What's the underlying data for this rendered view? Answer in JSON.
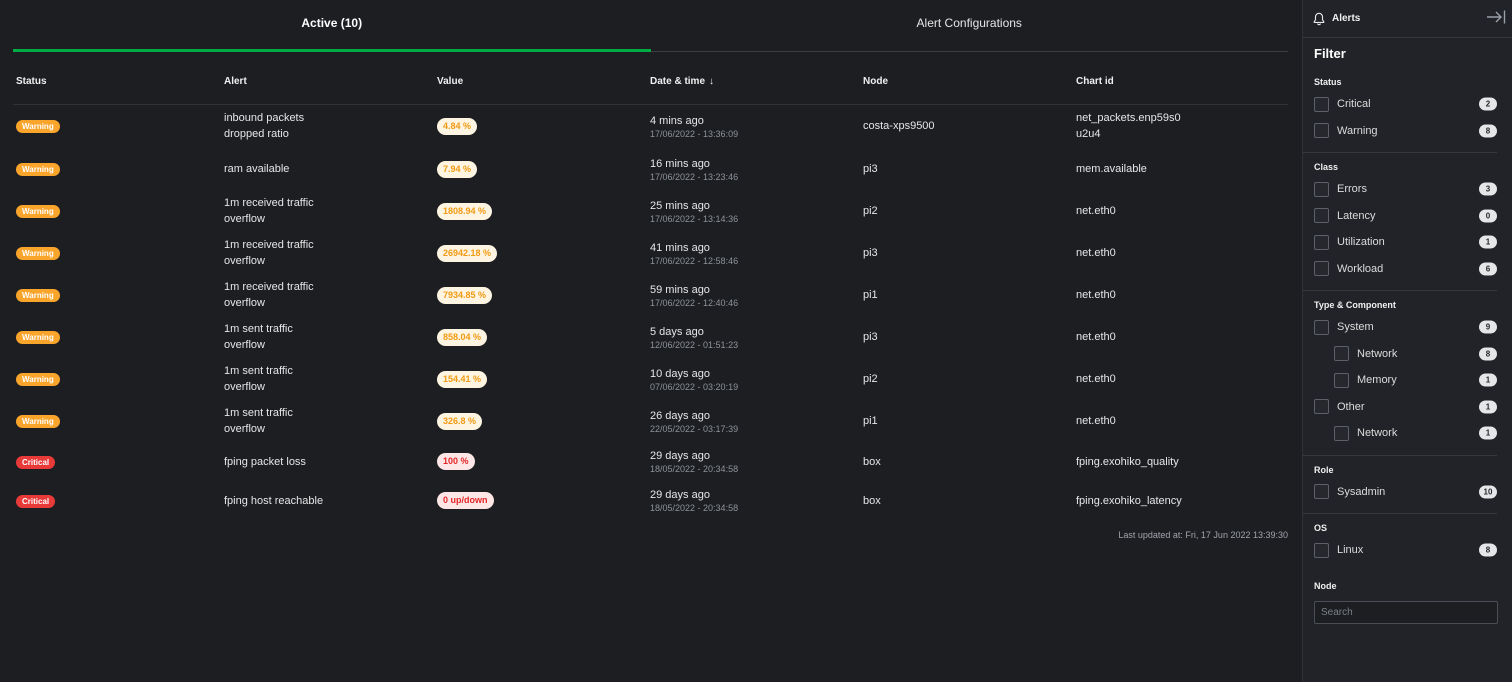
{
  "tabs": [
    {
      "label": "Active (10)",
      "active": true
    },
    {
      "label": "Alert Configurations",
      "active": false
    }
  ],
  "table": {
    "columns": [
      "Status",
      "Alert",
      "Value",
      "Date & time",
      "Node",
      "Chart id"
    ],
    "sorted_column": "Date & time",
    "rows": [
      {
        "status": "Warning",
        "alert_l1": "inbound packets",
        "alert_l2": "dropped ratio",
        "value": "4.84 %",
        "ago": "4 mins ago",
        "datetime": "17/06/2022 - 13:36:09",
        "node": "costa-xps9500",
        "chart_l1": "net_packets.enp59s0",
        "chart_l2": "u2u4"
      },
      {
        "status": "Warning",
        "alert_l1": "ram available",
        "alert_l2": "",
        "value": "7.94 %",
        "ago": "16 mins ago",
        "datetime": "17/06/2022 - 13:23:46",
        "node": "pi3",
        "chart_l1": "mem.available",
        "chart_l2": ""
      },
      {
        "status": "Warning",
        "alert_l1": "1m received traffic",
        "alert_l2": "overflow",
        "value": "1808.94 %",
        "ago": "25 mins ago",
        "datetime": "17/06/2022 - 13:14:36",
        "node": "pi2",
        "chart_l1": "net.eth0",
        "chart_l2": ""
      },
      {
        "status": "Warning",
        "alert_l1": "1m received traffic",
        "alert_l2": "overflow",
        "value": "26942.18 %",
        "ago": "41 mins ago",
        "datetime": "17/06/2022 - 12:58:46",
        "node": "pi3",
        "chart_l1": "net.eth0",
        "chart_l2": ""
      },
      {
        "status": "Warning",
        "alert_l1": "1m received traffic",
        "alert_l2": "overflow",
        "value": "7934.85 %",
        "ago": "59 mins ago",
        "datetime": "17/06/2022 - 12:40:46",
        "node": "pi1",
        "chart_l1": "net.eth0",
        "chart_l2": ""
      },
      {
        "status": "Warning",
        "alert_l1": "1m sent traffic",
        "alert_l2": "overflow",
        "value": "858.04 %",
        "ago": "5 days ago",
        "datetime": "12/06/2022 - 01:51:23",
        "node": "pi3",
        "chart_l1": "net.eth0",
        "chart_l2": ""
      },
      {
        "status": "Warning",
        "alert_l1": "1m sent traffic",
        "alert_l2": "overflow",
        "value": "154.41 %",
        "ago": "10 days ago",
        "datetime": "07/06/2022 - 03:20:19",
        "node": "pi2",
        "chart_l1": "net.eth0",
        "chart_l2": ""
      },
      {
        "status": "Warning",
        "alert_l1": "1m sent traffic",
        "alert_l2": "overflow",
        "value": "326.8 %",
        "ago": "26 days ago",
        "datetime": "22/05/2022 - 03:17:39",
        "node": "pi1",
        "chart_l1": "net.eth0",
        "chart_l2": ""
      },
      {
        "status": "Critical",
        "alert_l1": "fping packet loss",
        "alert_l2": "",
        "value": "100 %",
        "ago": "29 days ago",
        "datetime": "18/05/2022 - 20:34:58",
        "node": "box",
        "chart_l1": "fping.exohiko_quality",
        "chart_l2": ""
      },
      {
        "status": "Critical",
        "alert_l1": "fping host reachable",
        "alert_l2": "",
        "value": "0 up/down",
        "ago": "29 days ago",
        "datetime": "18/05/2022 - 20:34:58",
        "node": "box",
        "chart_l1": "fping.exohiko_latency",
        "chart_l2": ""
      }
    ]
  },
  "last_updated": "Last updated at: Fri, 17 Jun 2022 13:39:30",
  "sidebar": {
    "title": "Alerts",
    "filter_title": "Filter",
    "groups": [
      {
        "title": "Status",
        "options": [
          {
            "label": "Critical",
            "count": "2",
            "sub": false
          },
          {
            "label": "Warning",
            "count": "8",
            "sub": false
          }
        ]
      },
      {
        "title": "Class",
        "options": [
          {
            "label": "Errors",
            "count": "3",
            "sub": false
          },
          {
            "label": "Latency",
            "count": "0",
            "sub": false
          },
          {
            "label": "Utilization",
            "count": "1",
            "sub": false
          },
          {
            "label": "Workload",
            "count": "6",
            "sub": false
          }
        ]
      },
      {
        "title": "Type & Component",
        "options": [
          {
            "label": "System",
            "count": "9",
            "sub": false
          },
          {
            "label": "Network",
            "count": "8",
            "sub": true
          },
          {
            "label": "Memory",
            "count": "1",
            "sub": true
          },
          {
            "label": "Other",
            "count": "1",
            "sub": false
          },
          {
            "label": "Network",
            "count": "1",
            "sub": true
          }
        ]
      },
      {
        "title": "Role",
        "options": [
          {
            "label": "Sysadmin",
            "count": "10",
            "sub": false
          }
        ]
      },
      {
        "title": "OS",
        "options": [
          {
            "label": "Linux",
            "count": "8",
            "sub": false
          }
        ]
      }
    ],
    "node_group_title": "Node",
    "node_search_placeholder": "Search"
  },
  "colors": {
    "background": "#1c1e22",
    "accent": "#00ab44",
    "warning": "#f9a42b",
    "critical": "#e93a3a"
  }
}
